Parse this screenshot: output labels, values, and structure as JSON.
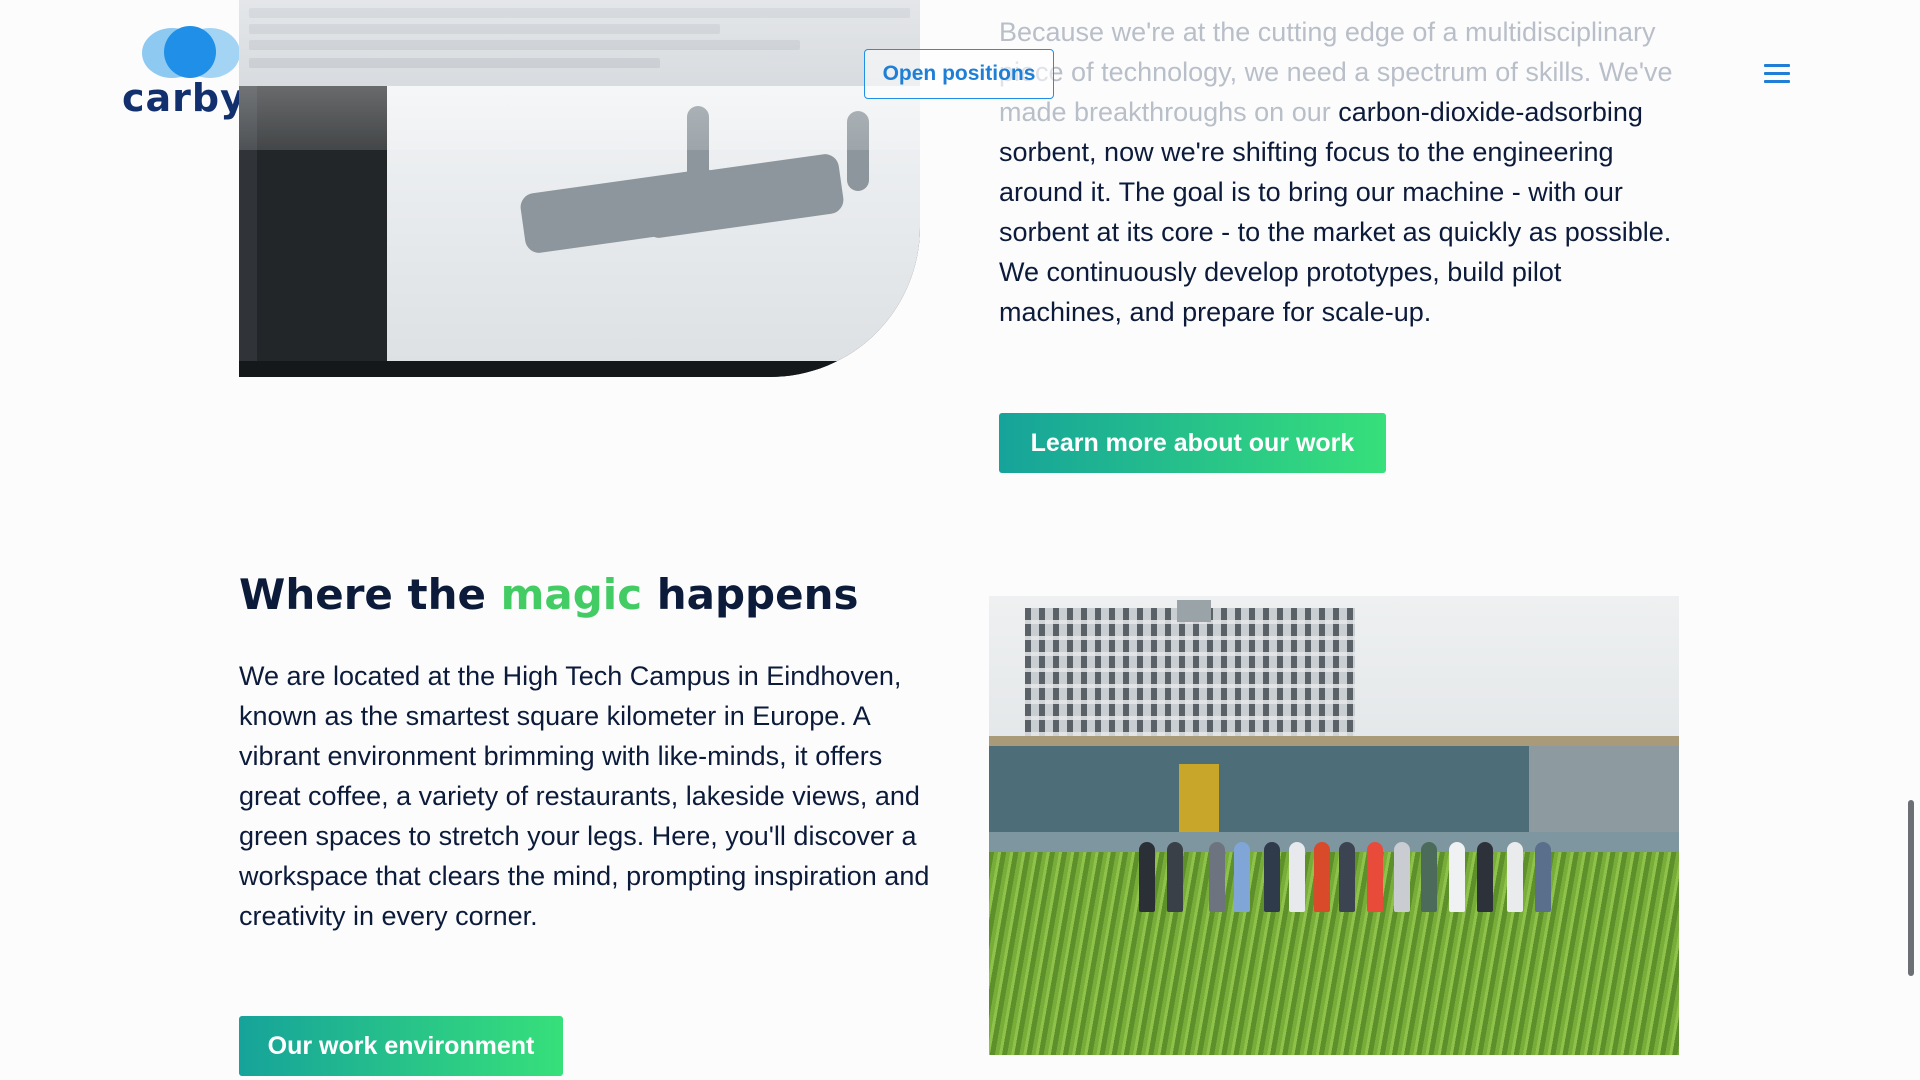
{
  "header": {
    "logo_text": "carbyon",
    "open_positions_label": "Open positions",
    "menu_icon": "hamburger-menu-icon"
  },
  "work": {
    "text_faded": "Because we're at the cutting edge of a multidisciplinary piece of technology, we need a spectrum of skills. We've made breakthroughs on our",
    "text_main": "carbon-dioxide-adsorbing sorbent, now we're shifting focus to the engineering around it. The goal is to bring our machine - with our sorbent at its core - to the market as quickly as possible. We continuously develop prototypes, build pilot machines, and prepare for scale-up.",
    "button_label": "Learn more about our work"
  },
  "campus": {
    "title_before": "Where the ",
    "title_accent": "magic",
    "title_after": " happens",
    "body": "We are located at the High Tech Campus in Eindhoven, known as the smartest square kilometer in Europe. A vibrant environment brimming with like-minds, it offers great coffee, a variety of restaurants, lakeside views, and green spaces to stretch your legs. Here, you'll discover a workspace that clears the mind, prompting inspiration and creativity in every corner.",
    "button_label": "Our work environment"
  },
  "colors": {
    "brand_blue": "#1f8fe8",
    "text_navy": "#0c1b3a",
    "accent_green": "#43cc64",
    "button_gradient_start": "#16a39a",
    "button_gradient_end": "#37e07a"
  }
}
